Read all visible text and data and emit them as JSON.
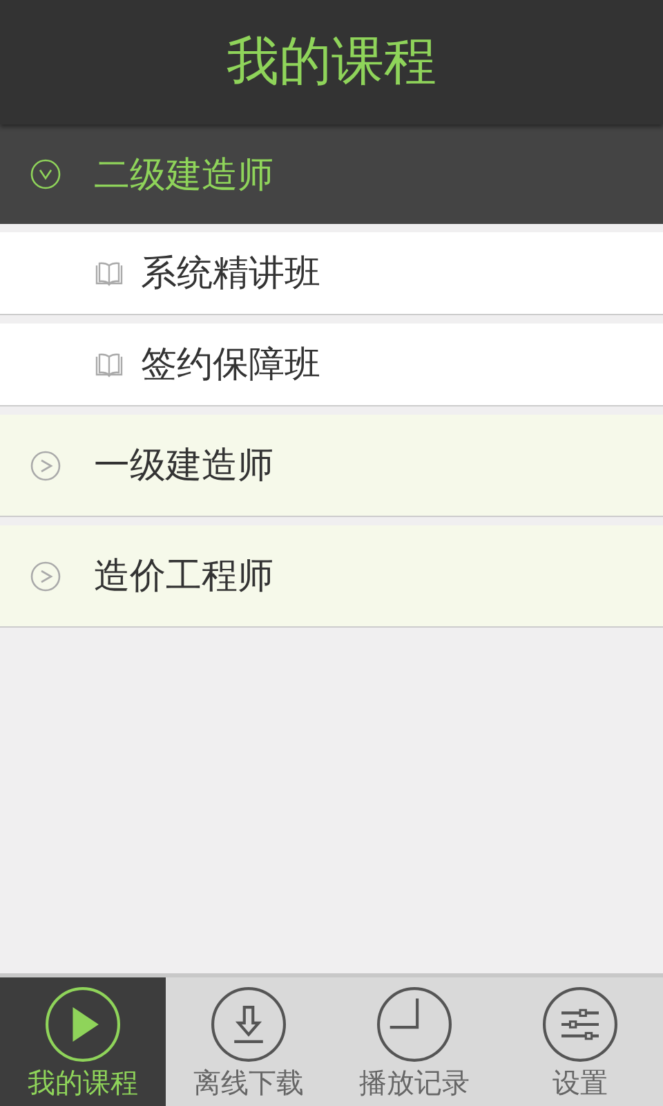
{
  "header": {
    "title": "我的课程"
  },
  "categories": [
    {
      "label": "二级建造师",
      "expanded": true,
      "children": [
        {
          "label": "系统精讲班"
        },
        {
          "label": "签约保障班"
        }
      ]
    },
    {
      "label": "一级建造师",
      "expanded": false
    },
    {
      "label": "造价工程师",
      "expanded": false
    }
  ],
  "tabs": [
    {
      "label": "我的课程",
      "kind": "play",
      "selected": true
    },
    {
      "label": "离线下载",
      "kind": "download",
      "selected": false
    },
    {
      "label": "播放记录",
      "kind": "clock",
      "selected": false
    },
    {
      "label": "设置",
      "kind": "sliders",
      "selected": false
    }
  ]
}
